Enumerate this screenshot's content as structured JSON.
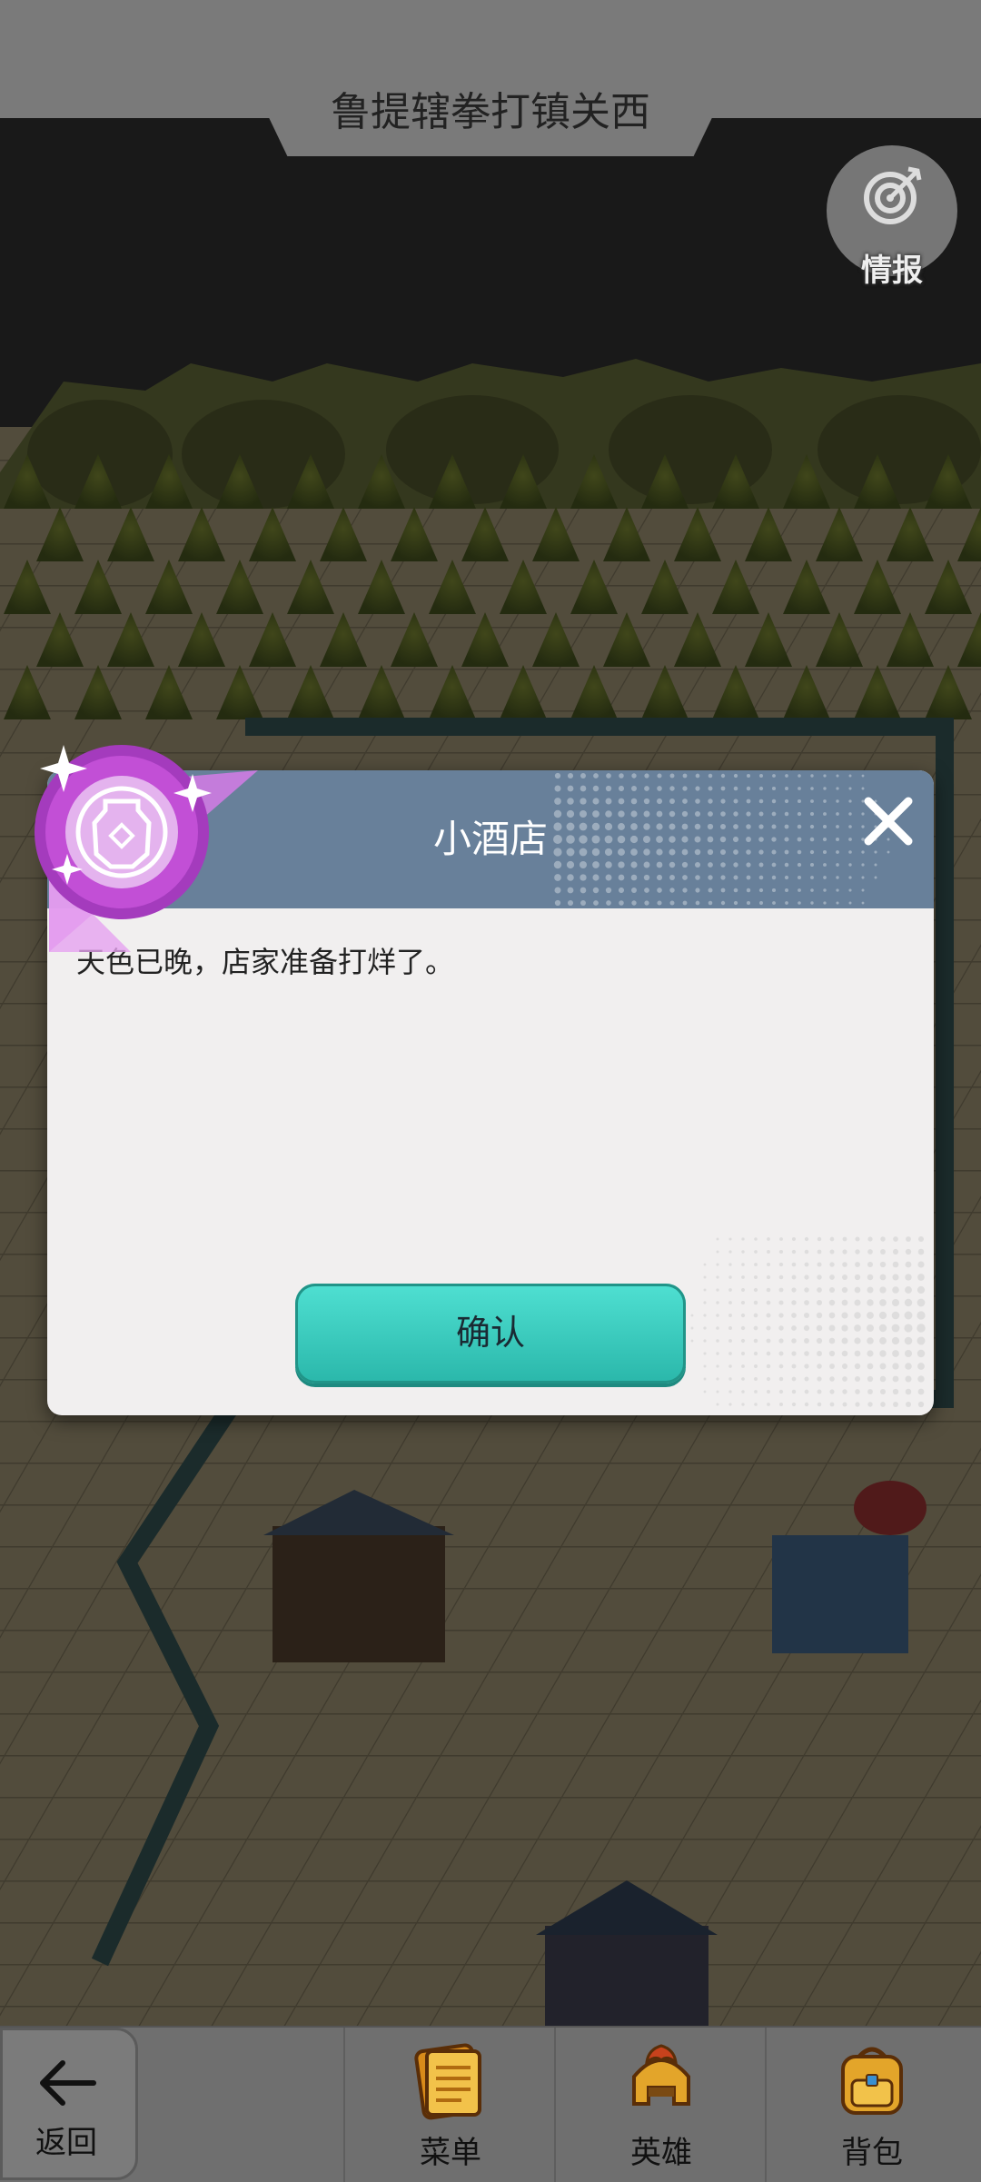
{
  "header": {
    "title": "鲁提辖拳打镇关西"
  },
  "intel_button": {
    "label": "情报",
    "icon": "target-dart-icon"
  },
  "dialog": {
    "title": "小酒店",
    "message": "天色已晚，店家准备打烊了。",
    "confirm_label": "确认",
    "close_icon": "close-icon",
    "badge_icon": "jar-icon",
    "header_color": "#68809a",
    "confirm_color": "#3ccfc2",
    "badge_color": "#c24fd6"
  },
  "bottom_nav": {
    "back_label": "返回",
    "items": [
      {
        "label": "菜单",
        "icon": "scroll-menu-icon"
      },
      {
        "label": "英雄",
        "icon": "hero-helmet-icon"
      },
      {
        "label": "背包",
        "icon": "backpack-icon"
      }
    ]
  }
}
